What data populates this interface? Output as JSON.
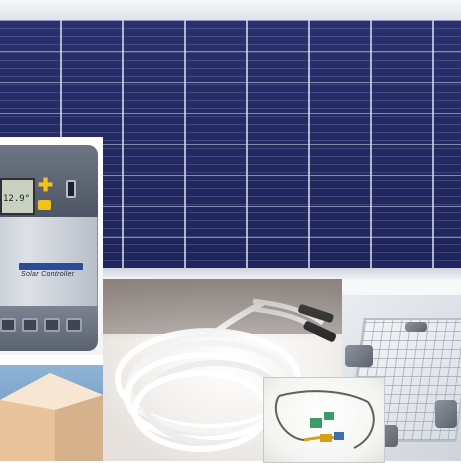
{
  "controller": {
    "lcd_text": "12.9°",
    "label": "Solar Controller"
  },
  "mounting_kit": {
    "text_lines": [
      "",
      "",
      "",
      ""
    ]
  },
  "colors": {
    "panel": "#252c66",
    "controller_accent": "#f2c21b",
    "bracket": "#5e646d"
  }
}
